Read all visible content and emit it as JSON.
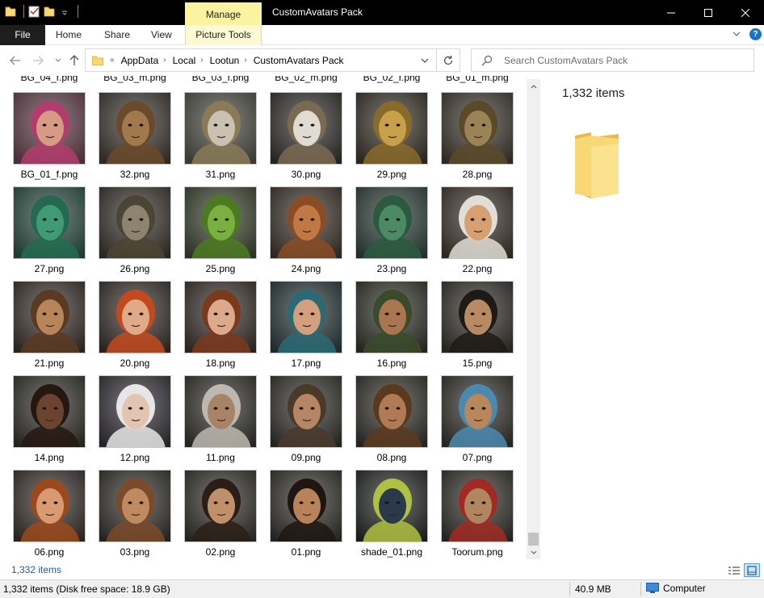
{
  "window": {
    "title": "CustomAvatars Pack",
    "manage_label": "Manage",
    "controls": {
      "minimize": "—",
      "maximize": "☐",
      "close": "✕"
    }
  },
  "ribbon": {
    "file_label": "File",
    "tabs": [
      "Home",
      "Share",
      "View"
    ],
    "picture_tools_label": "Picture Tools"
  },
  "address": {
    "overflow": "«",
    "crumbs": [
      "AppData",
      "Local",
      "Lootun",
      "CustomAvatars Pack"
    ],
    "separator": "›"
  },
  "search": {
    "placeholder": "Search CustomAvatars Pack"
  },
  "files": {
    "partial_row": [
      "BG_04_f.png",
      "BG_03_m.png",
      "BG_03_f.png",
      "BG_02_m.png",
      "BG_02_f.png",
      "BG_01_m.png"
    ],
    "items": [
      {
        "name": "BG_01_f.png",
        "bg": "#4a2e38",
        "skin": "#d79a84",
        "hair": "#b23c6c"
      },
      {
        "name": "32.png",
        "bg": "#2e2924",
        "skin": "#a07a4c",
        "hair": "#6a4a2a"
      },
      {
        "name": "31.png",
        "bg": "#3a3a34",
        "skin": "#c9c2b0",
        "hair": "#8a7a56"
      },
      {
        "name": "30.png",
        "bg": "#262421",
        "skin": "#e0dcd4",
        "hair": "#7a6a52"
      },
      {
        "name": "29.png",
        "bg": "#2a261e",
        "skin": "#c8a04a",
        "hair": "#8a6a2a"
      },
      {
        "name": "28.png",
        "bg": "#2e2a22",
        "skin": "#9a8456",
        "hair": "#5a4a2a"
      },
      {
        "name": "27.png",
        "bg": "#1f3a32",
        "skin": "#3f9a76",
        "hair": "#256a50"
      },
      {
        "name": "26.png",
        "bg": "#2a2620",
        "skin": "#8c8470",
        "hair": "#4c4434"
      },
      {
        "name": "25.png",
        "bg": "#2c3322",
        "skin": "#7ab040",
        "hair": "#4c7a22"
      },
      {
        "name": "24.png",
        "bg": "#2e2620",
        "skin": "#c07844",
        "hair": "#8a4c24"
      },
      {
        "name": "23.png",
        "bg": "#22302a",
        "skin": "#4c8a64",
        "hair": "#2c5a40"
      },
      {
        "name": "22.png",
        "bg": "#2e2620",
        "skin": "#d6a070",
        "hair": "#e0ded6"
      },
      {
        "name": "21.png",
        "bg": "#2a2420",
        "skin": "#b8845a",
        "hair": "#5a3a22"
      },
      {
        "name": "20.png",
        "bg": "#2a2420",
        "skin": "#e0aa88",
        "hair": "#c24a1e"
      },
      {
        "name": "18.png",
        "bg": "#2a2420",
        "skin": "#dcaa8a",
        "hair": "#7a3a1c"
      },
      {
        "name": "17.png",
        "bg": "#1f2a2a",
        "skin": "#d2a07c",
        "hair": "#2a6a74"
      },
      {
        "name": "16.png",
        "bg": "#24261e",
        "skin": "#a87650",
        "hair": "#3a4a2a"
      },
      {
        "name": "15.png",
        "bg": "#262420",
        "skin": "#b88a64",
        "hair": "#1e1a16"
      },
      {
        "name": "14.png",
        "bg": "#262420",
        "skin": "#6a4430",
        "hair": "#241810"
      },
      {
        "name": "12.png",
        "bg": "#262428",
        "skin": "#e2c4b0",
        "hair": "#e6e6e6"
      },
      {
        "name": "11.png",
        "bg": "#262420",
        "skin": "#a88466",
        "hair": "#bcb8b0"
      },
      {
        "name": "09.png",
        "bg": "#262420",
        "skin": "#b48664",
        "hair": "#4a3a2a"
      },
      {
        "name": "08.png",
        "bg": "#262420",
        "skin": "#b07a54",
        "hair": "#5a3a1e"
      },
      {
        "name": "07.png",
        "bg": "#262420",
        "skin": "#b8885c",
        "hair": "#4a8ab0"
      },
      {
        "name": "06.png",
        "bg": "#2a2420",
        "skin": "#d89a70",
        "hair": "#9a4a1c"
      },
      {
        "name": "03.png",
        "bg": "#262420",
        "skin": "#c08a60",
        "hair": "#7a4a2a"
      },
      {
        "name": "02.png",
        "bg": "#262420",
        "skin": "#c0906a",
        "hair": "#2a1e16"
      },
      {
        "name": "01.png",
        "bg": "#262420",
        "skin": "#b8825a",
        "hair": "#1e1610"
      },
      {
        "name": "shade_01.png",
        "bg": "#1a1e1a",
        "skin": "#2a3a4a",
        "hair": "#b0c040"
      },
      {
        "name": "Toorum.png",
        "bg": "#262420",
        "skin": "#b08660",
        "hair": "#a02a24"
      }
    ]
  },
  "details": {
    "count": "1,332 items"
  },
  "footer": {
    "count": "1,332 items"
  },
  "statusbar": {
    "left": "1,332 items (Disk free space: 18.9 GB)",
    "size": "40.9 MB",
    "location": "Computer"
  },
  "colors": {
    "title_bg": "#000000",
    "manage": "#fbf3a0",
    "folder": "#f8d775",
    "link": "#1e5aa8"
  }
}
